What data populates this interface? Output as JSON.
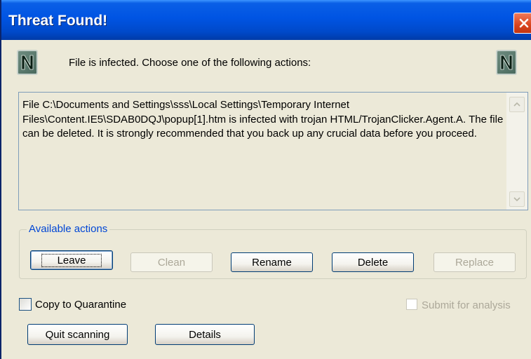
{
  "window": {
    "title": "Threat Found!",
    "title_bar_color": "#0054e3",
    "close_button_color": "#d9431e"
  },
  "message": "File is infected. Choose one of the following actions:",
  "details_text": "File C:\\Documents and Settings\\sss\\Local Settings\\Temporary Internet Files\\Content.IE5\\SDAB0DQJ\\popup[1].htm is infected with trojan HTML/TrojanClicker.Agent.A. The file can be deleted. It is strongly recommended that you back up any crucial data before you proceed.",
  "actions_group": {
    "label": "Available actions",
    "buttons": [
      {
        "label": "Leave",
        "enabled": true,
        "default": true
      },
      {
        "label": "Clean",
        "enabled": false
      },
      {
        "label": "Rename",
        "enabled": true
      },
      {
        "label": "Delete",
        "enabled": true
      },
      {
        "label": "Replace",
        "enabled": false
      }
    ]
  },
  "options": {
    "quarantine": {
      "label": "Copy to Quarantine",
      "checked": false,
      "enabled": true
    },
    "submit": {
      "label": "Submit for analysis",
      "checked": false,
      "enabled": false
    }
  },
  "footer": {
    "quit_label": "Quit scanning",
    "details_label": "Details"
  },
  "icons": {
    "logo": "app-logo-icon",
    "close": "close-icon",
    "scroll_up": "scroll-up-arrow-icon",
    "scroll_down": "scroll-down-arrow-icon"
  }
}
